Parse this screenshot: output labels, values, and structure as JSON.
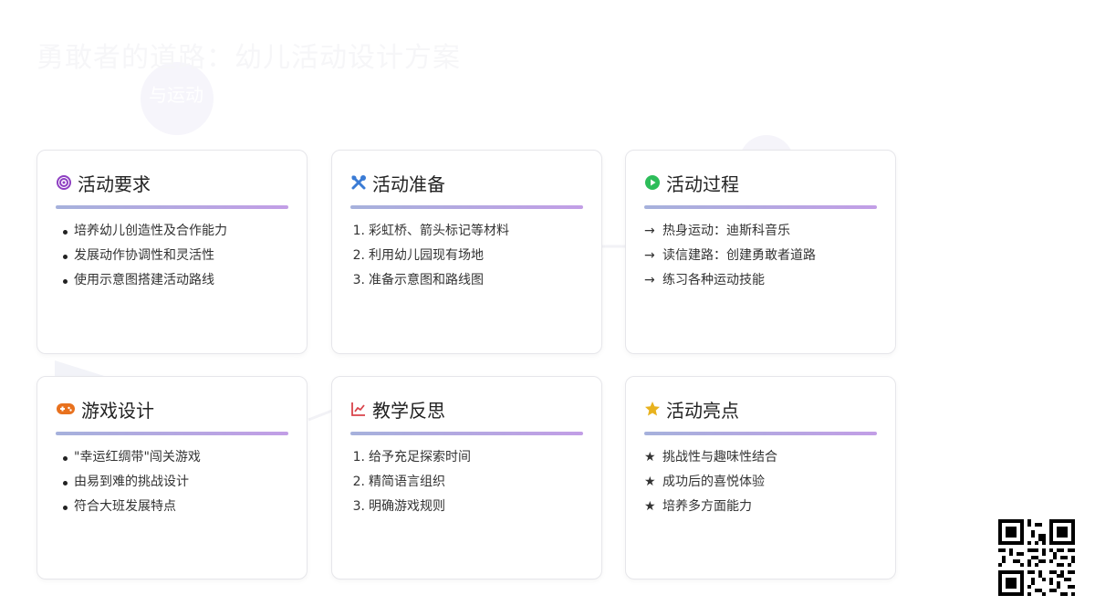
{
  "page": {
    "title": "勇敢者的道路：幼儿活动设计方案",
    "bubble_text": "与运动"
  },
  "cards": [
    {
      "title": "活动要求",
      "icon": "target-icon",
      "icon_color": "#8e3fc2",
      "list_style": "bullet",
      "items": [
        "培养幼儿创造性及合作能力",
        "发展动作协调性和灵活性",
        "使用示意图搭建活动路线"
      ]
    },
    {
      "title": "活动准备",
      "icon": "tools-icon",
      "icon_color": "#3a7bd5",
      "list_style": "numbered",
      "items": [
        "彩虹桥、箭头标记等材料",
        "利用幼儿园现有场地",
        "准备示意图和路线图"
      ]
    },
    {
      "title": "活动过程",
      "icon": "play-circle-icon",
      "icon_color": "#2dbd5a",
      "list_style": "arrow",
      "marker": "→",
      "items": [
        "热身运动：迪斯科音乐",
        "读信建路：创建勇敢者道路",
        "练习各种运动技能"
      ]
    },
    {
      "title": "游戏设计",
      "icon": "gamepad-icon",
      "icon_color": "#e8711e",
      "list_style": "bullet",
      "items": [
        "\"幸运红绸带\"闯关游戏",
        "由易到难的挑战设计",
        "符合大班发展特点"
      ]
    },
    {
      "title": "教学反思",
      "icon": "line-chart-icon",
      "icon_color": "#d9434a",
      "list_style": "numbered",
      "items": [
        "给予充足探索时间",
        "精简语言组织",
        "明确游戏规则"
      ]
    },
    {
      "title": "活动亮点",
      "icon": "star-icon",
      "icon_color": "#e8b21e",
      "list_style": "star",
      "marker": "★",
      "items": [
        "挑战性与趣味性结合",
        "成功后的喜悦体验",
        "培养多方面能力"
      ]
    }
  ]
}
